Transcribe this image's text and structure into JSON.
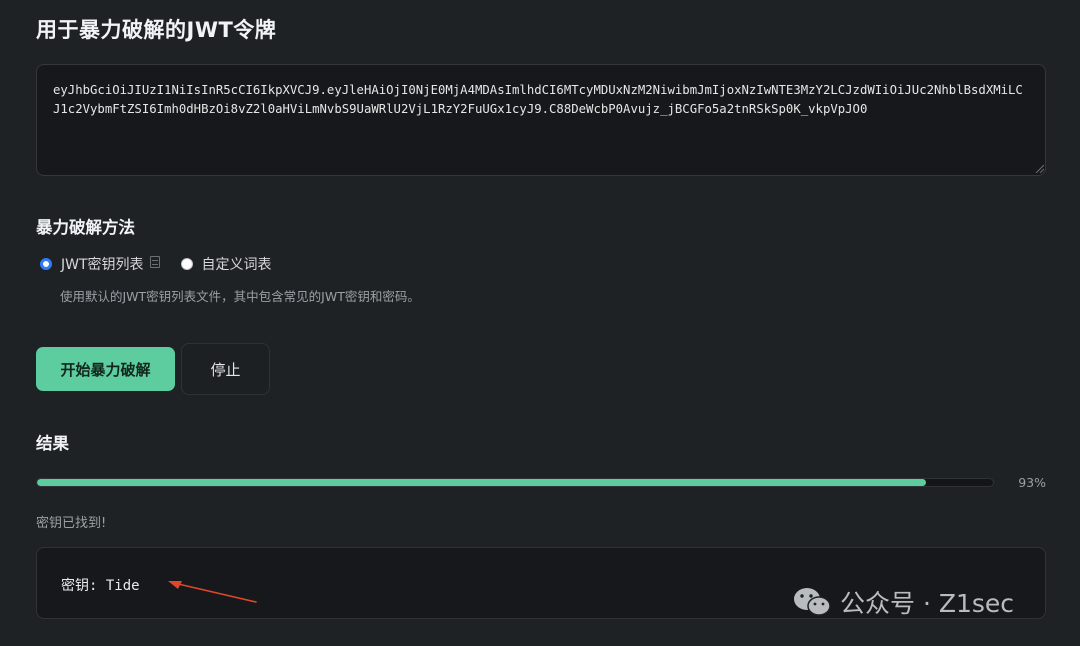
{
  "page": {
    "title": "用于暴力破解的JWT令牌"
  },
  "token": {
    "value": "eyJhbGciOiJIUzI1NiIsInR5cCI6IkpXVCJ9.eyJleHAiOjI0NjE0MjA4MDAsImlhdCI6MTcyMDUxNzM2NiwibmJmIjoxNzIwNTE3MzY2LCJzdWIiOiJUc2NhblBsdXMiLCJ1c2VybmFtZSI6Imh0dHBzOi8vZ2l0aHViLmNvbS9UaWRlU2VjL1RzY2FuUGx1cyJ9.C88DeWcbP0Avujz_jBCGFo5a2tnRSkSp0K_vkpVpJO0"
  },
  "method": {
    "heading": "暴力破解方法",
    "options": [
      {
        "label": "JWT密钥列表",
        "checked": true
      },
      {
        "label": "自定义词表",
        "checked": false
      }
    ],
    "hint": "使用默认的JWT密钥列表文件，其中包含常见的JWT密钥和密码。"
  },
  "actions": {
    "start_label": "开始暴力破解",
    "stop_label": "停止"
  },
  "result": {
    "heading": "结果",
    "progress_percent": 93,
    "progress_label": "93%",
    "status": "密钥已找到!",
    "output": "密钥: Tide"
  },
  "watermark": {
    "text": "公众号 · Z1sec"
  },
  "colors": {
    "accent": "#5dcda0",
    "background": "#1f2225",
    "radio_checked": "#2f7cf6",
    "arrow": "#e0462c"
  }
}
